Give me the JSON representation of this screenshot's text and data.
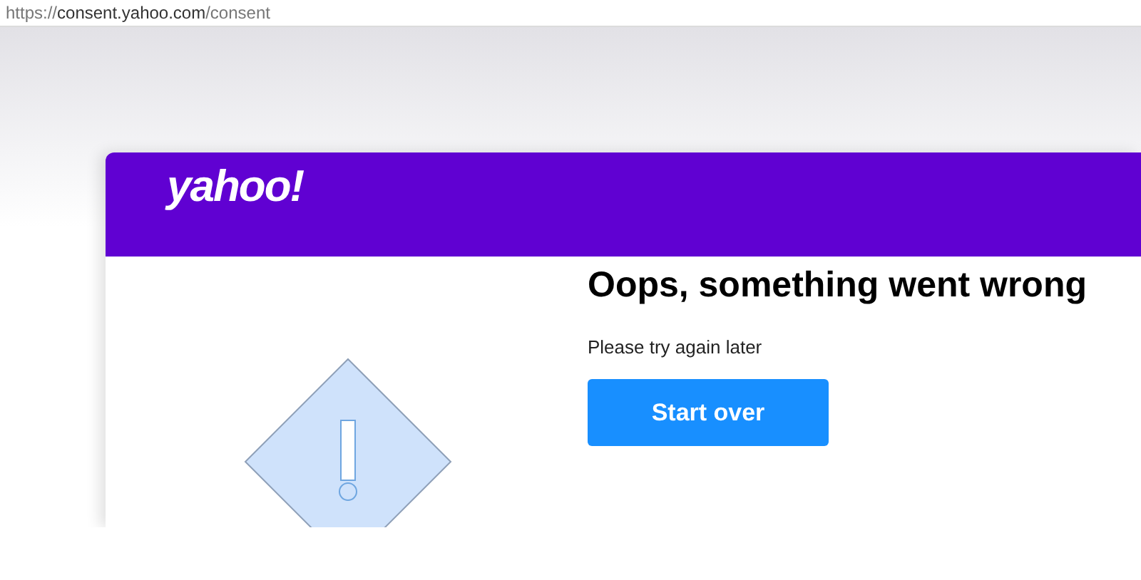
{
  "address_bar": {
    "scheme": "https://",
    "host": "consent.yahoo.com",
    "path": "/consent"
  },
  "header": {
    "logo": "yahoo!"
  },
  "error": {
    "title": "Oops, something went wrong",
    "message": "Please try again later",
    "button": "Start over"
  }
}
